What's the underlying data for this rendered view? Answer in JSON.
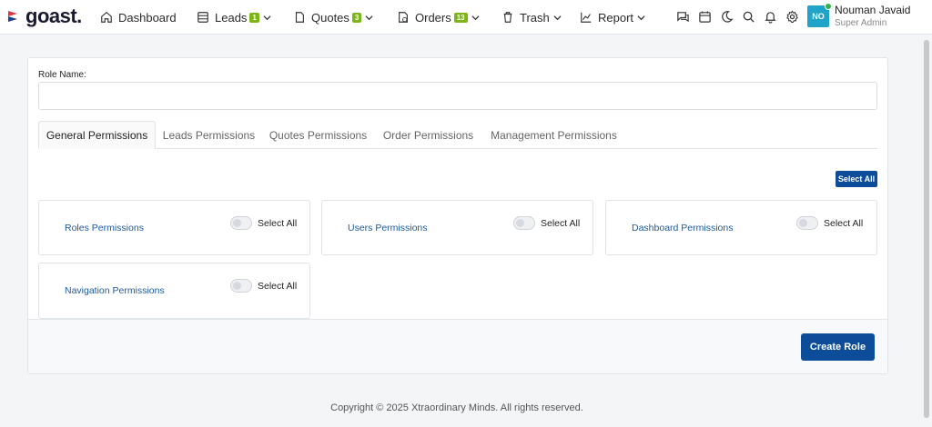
{
  "header": {
    "logo_text": "goast.",
    "nav": [
      {
        "label": "Dashboard"
      },
      {
        "label": "Leads",
        "badge": "1"
      },
      {
        "label": "Quotes",
        "badge": "3"
      },
      {
        "label": "Orders",
        "badge": "13"
      },
      {
        "label": "Trash"
      },
      {
        "label": "Report"
      }
    ],
    "icons": [
      "chat-icon",
      "calendar-icon",
      "moon-icon",
      "search-icon",
      "bell-icon",
      "gear-icon"
    ],
    "user": {
      "initials": "NO",
      "name": "Nouman Javaid",
      "role": "Super Admin"
    },
    "colors": {
      "badge": "#7cb518",
      "avatar": "#1fa3c9",
      "online": "#2fb344"
    }
  },
  "form": {
    "role_label": "Role Name:",
    "role_value": "",
    "tabs": [
      {
        "label": "General Permissions",
        "active": true
      },
      {
        "label": "Leads Permissions"
      },
      {
        "label": "Quotes Permissions"
      },
      {
        "label": "Order Permissions"
      },
      {
        "label": "Management Permissions"
      }
    ],
    "select_all_button": "Select All",
    "permissions": [
      {
        "title": "Roles Permissions",
        "toggle_label": "Select All",
        "enabled": false
      },
      {
        "title": "Users Permissions",
        "toggle_label": "Select All",
        "enabled": false
      },
      {
        "title": "Dashboard Permissions",
        "toggle_label": "Select All",
        "enabled": false
      },
      {
        "title": "Navigation Permissions",
        "toggle_label": "Select All",
        "enabled": false
      }
    ],
    "submit_button": "Create Role",
    "primary_color": "#0d4c99"
  },
  "footer": {
    "copyright": "Copyright © 2025 Xtraordinary Minds. All rights reserved."
  }
}
